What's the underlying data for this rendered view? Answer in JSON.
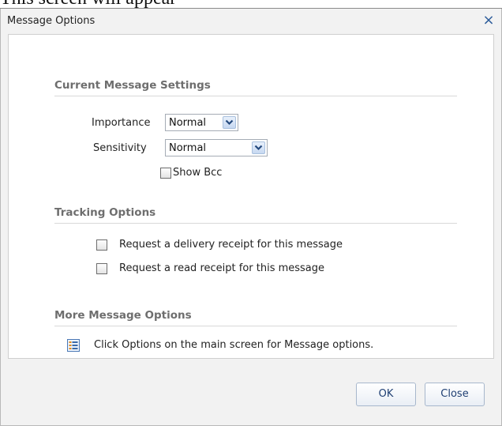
{
  "page_caption": "This screen will appear",
  "dialog": {
    "title": "Message Options",
    "close_glyph": "×"
  },
  "sections": {
    "current": {
      "header": "Current Message Settings",
      "importance_label": "Importance",
      "importance_value": "Normal",
      "sensitivity_label": "Sensitivity",
      "sensitivity_value": "Normal",
      "show_bcc_label": "Show Bcc",
      "show_bcc_checked": false
    },
    "tracking": {
      "header": "Tracking Options",
      "delivery_receipt_label": "Request a delivery receipt for this message",
      "delivery_receipt_checked": false,
      "read_receipt_label": "Request a read receipt for this message",
      "read_receipt_checked": false
    },
    "more": {
      "header": "More Message Options",
      "info_text": "Click Options on the main screen for Message options.",
      "info_icon": "list-options-icon"
    }
  },
  "buttons": {
    "ok": "OK",
    "close": "Close"
  },
  "colors": {
    "accent": "#2c5c9a",
    "header_text": "#6e6e6e",
    "button_text": "#1f3f73"
  }
}
